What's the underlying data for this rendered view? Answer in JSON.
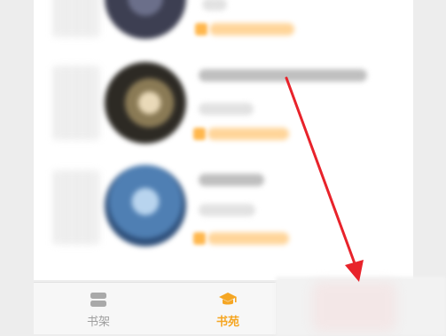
{
  "tabbar": {
    "shelf": {
      "label": "书架",
      "icon": "stack-icon",
      "color": "#9e9e9e"
    },
    "bookstore": {
      "label": "书苑",
      "icon": "graduation-cap-icon",
      "color": "#f5a623"
    }
  },
  "colors": {
    "accent": "#f5a623",
    "annotation": "#e8232b"
  }
}
